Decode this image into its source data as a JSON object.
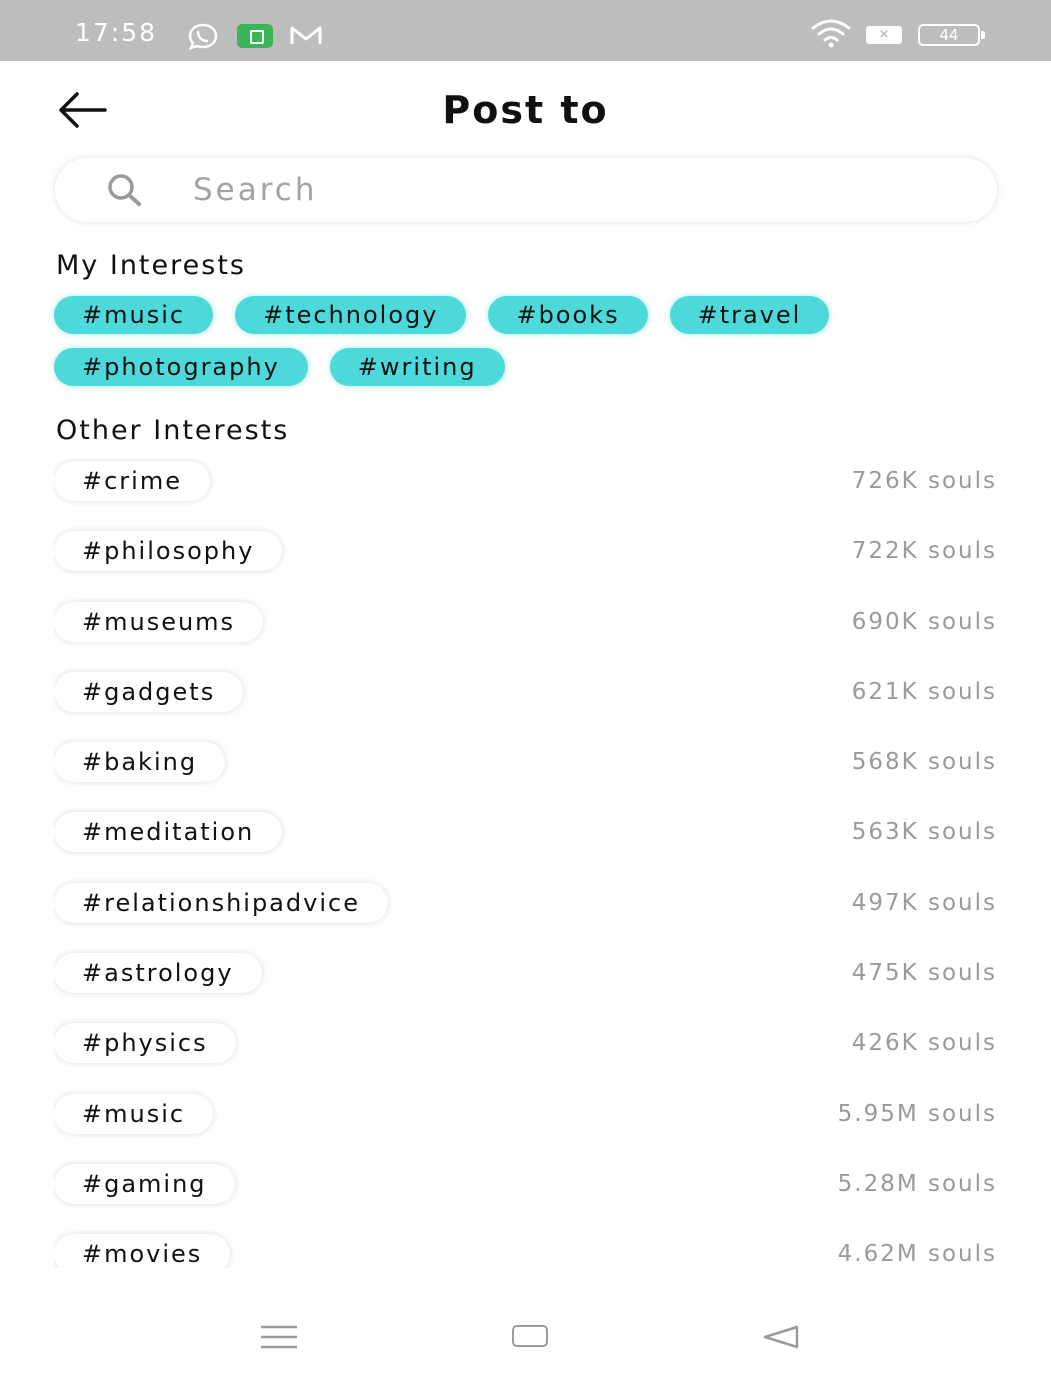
{
  "status_bar": {
    "time": "17:58",
    "icons": [
      "whatsapp-icon",
      "app-notification-icon",
      "gmail-icon",
      "wifi-icon",
      "sim-icon",
      "battery-icon"
    ],
    "sim_label": "×",
    "battery_level": "44"
  },
  "header": {
    "title": "Post to",
    "back_icon": "arrow-left-icon"
  },
  "search": {
    "placeholder": "Search",
    "value": "",
    "icon": "search-icon"
  },
  "my_interests": {
    "title": "My Interests",
    "rows": [
      [
        "#music",
        "#technology",
        "#books",
        "#travel"
      ],
      [
        "#photography",
        "#writing"
      ]
    ],
    "chip_color": "#4dd9d9"
  },
  "other_interests": {
    "title": "Other Interests",
    "items": [
      {
        "tag": "#crime",
        "count": "726K souls"
      },
      {
        "tag": "#philosophy",
        "count": "722K souls"
      },
      {
        "tag": "#museums",
        "count": "690K souls"
      },
      {
        "tag": "#gadgets",
        "count": "621K souls"
      },
      {
        "tag": "#baking",
        "count": "568K souls"
      },
      {
        "tag": "#meditation",
        "count": "563K souls"
      },
      {
        "tag": "#relationshipadvice",
        "count": "497K souls"
      },
      {
        "tag": "#astrology",
        "count": "475K souls"
      },
      {
        "tag": "#physics",
        "count": "426K souls"
      },
      {
        "tag": "#music",
        "count": "5.95M souls"
      },
      {
        "tag": "#gaming",
        "count": "5.28M souls"
      },
      {
        "tag": "#movies",
        "count": "4.62M souls"
      }
    ]
  },
  "nav_bar": {
    "icons": [
      "menu-icon",
      "home-icon",
      "back-triangle-icon"
    ]
  }
}
